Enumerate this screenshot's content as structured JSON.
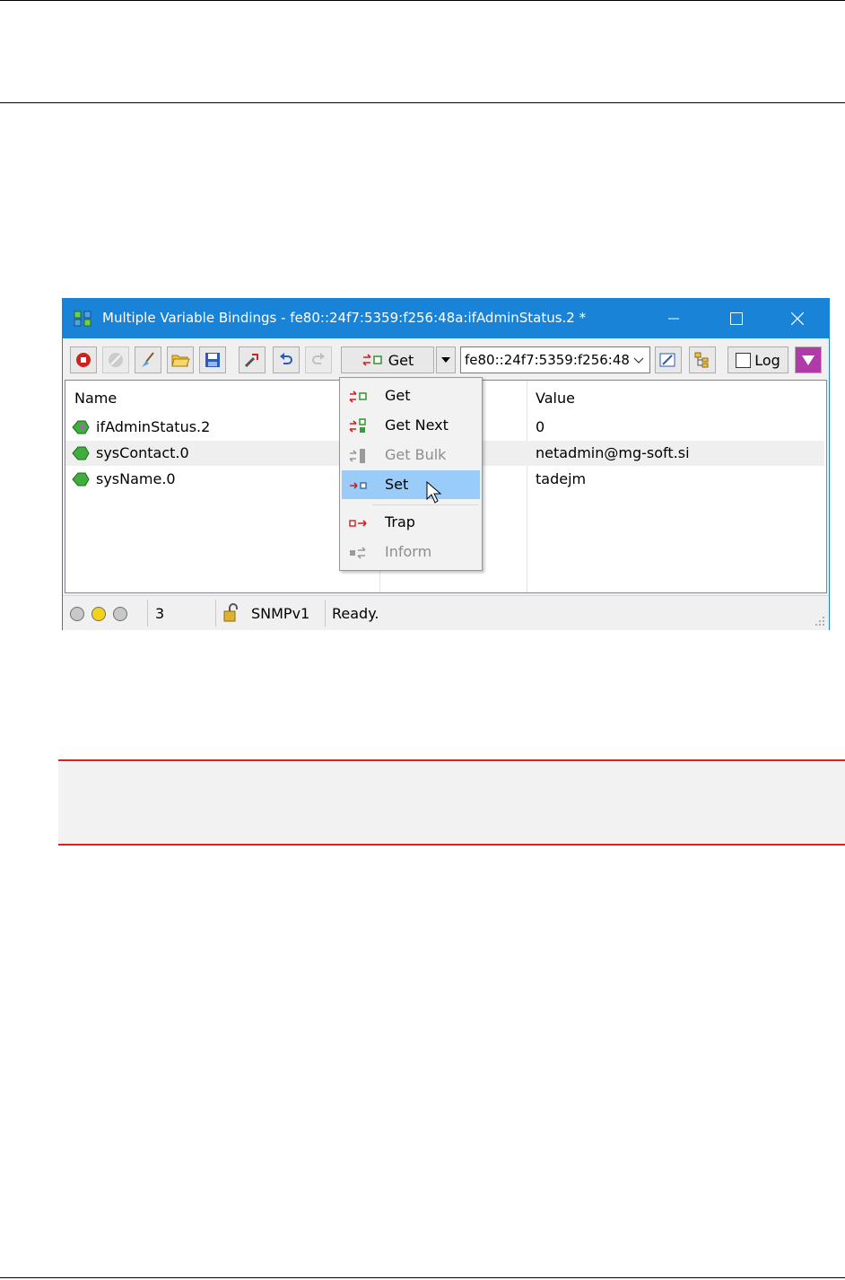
{
  "window": {
    "title": "Multiple Variable Bindings - fe80::24f7:5359:f256:48a:ifAdminStatus.2 *",
    "minimize": "—",
    "maximize": "☐",
    "close": "✕"
  },
  "toolbar": {
    "get_label": "Get",
    "address": "fe80::24f7:5359:f256:48",
    "log_label": "Log"
  },
  "list": {
    "columns": [
      "Name",
      "Value"
    ],
    "rows": [
      {
        "name": "ifAdminStatus.2",
        "value": "0"
      },
      {
        "name": "sysContact.0",
        "value": "netadmin@mg-soft.si"
      },
      {
        "name": "sysName.0",
        "value": "tadejm"
      }
    ]
  },
  "menu": {
    "items": [
      {
        "label": "Get",
        "state": "enabled"
      },
      {
        "label": "Get Next",
        "state": "enabled"
      },
      {
        "label": "Get Bulk",
        "state": "disabled"
      },
      {
        "label": "Set",
        "state": "highlighted"
      },
      {
        "label": "Trap",
        "state": "enabled"
      },
      {
        "label": "Inform",
        "state": "disabled"
      }
    ]
  },
  "status": {
    "count": "3",
    "protocol": "SNMPv1",
    "message": "Ready."
  },
  "colors": {
    "titlebar": "#1883d7",
    "highlight": "#99ccf9",
    "note_border": "#e02020"
  }
}
